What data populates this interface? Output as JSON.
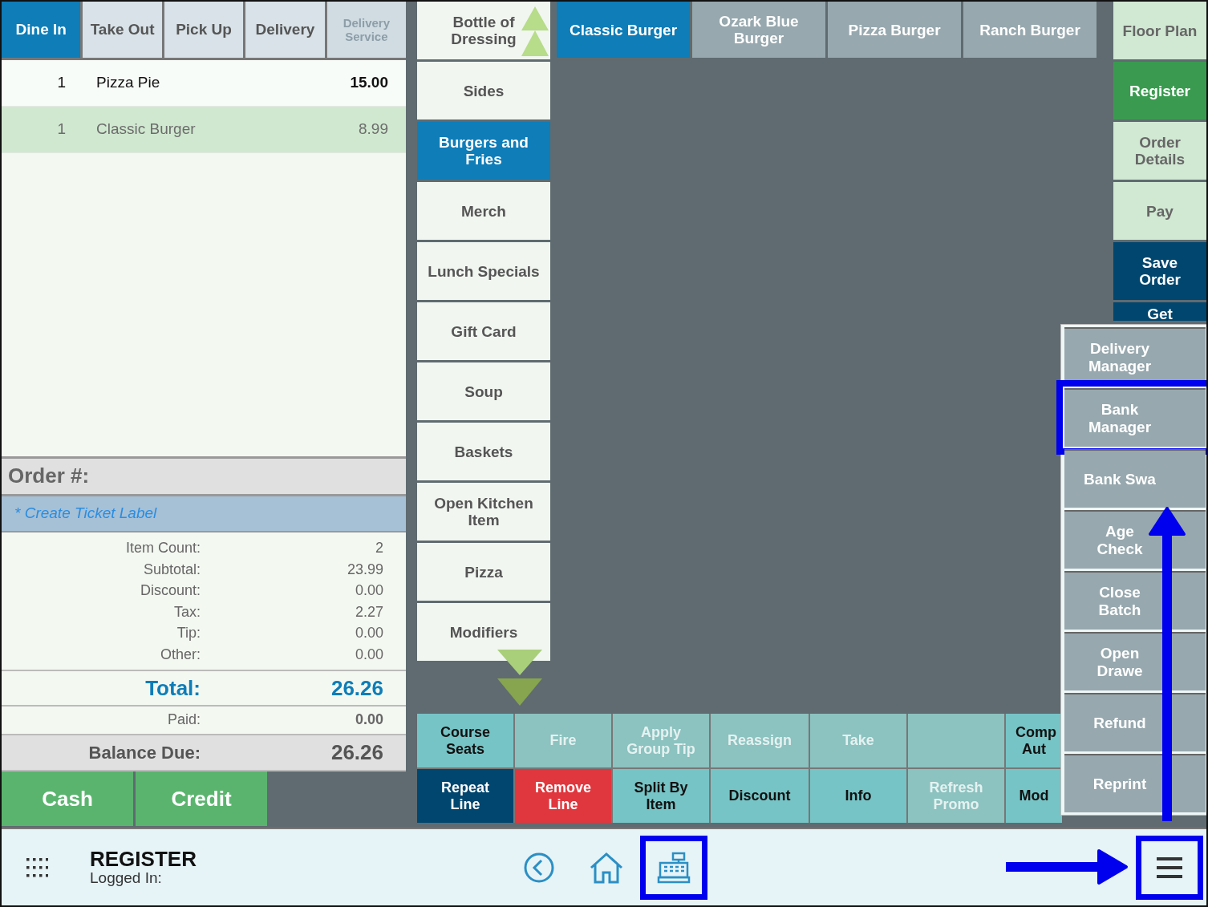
{
  "order_types": [
    {
      "label": "Dine In",
      "selected": true,
      "disabled": false
    },
    {
      "label": "Take Out",
      "selected": false,
      "disabled": false
    },
    {
      "label": "Pick Up",
      "selected": false,
      "disabled": false
    },
    {
      "label": "Delivery",
      "selected": false,
      "disabled": false
    },
    {
      "label": "Delivery Service",
      "selected": false,
      "disabled": true
    }
  ],
  "order_lines": [
    {
      "qty": "1",
      "name": "Pizza Pie",
      "price": "15.00",
      "selected": false
    },
    {
      "qty": "1",
      "name": "Classic Burger",
      "price": "8.99",
      "selected": true
    }
  ],
  "order": {
    "number_label": "Order #:",
    "ticket_label": "* Create Ticket Label",
    "summary": [
      {
        "label": "Item Count:",
        "value": "2"
      },
      {
        "label": "Subtotal:",
        "value": "23.99"
      },
      {
        "label": "Discount:",
        "value": "0.00"
      },
      {
        "label": "Tax:",
        "value": "2.27"
      },
      {
        "label": "Tip:",
        "value": "0.00"
      },
      {
        "label": "Other:",
        "value": "0.00"
      }
    ],
    "total": {
      "label": "Total:",
      "value": "26.26"
    },
    "paid": {
      "label": "Paid:",
      "value": "0.00"
    },
    "balance_due": {
      "label": "Balance Due:",
      "value": "26.26"
    }
  },
  "payment_buttons": [
    "Cash",
    "Credit"
  ],
  "categories": [
    {
      "label": "Bottle of Dressing",
      "selected": false
    },
    {
      "label": "Sides",
      "selected": false
    },
    {
      "label": "Burgers and Fries",
      "selected": true
    },
    {
      "label": "Merch",
      "selected": false
    },
    {
      "label": "Lunch Specials",
      "selected": false
    },
    {
      "label": "Gift Card",
      "selected": false
    },
    {
      "label": "Soup",
      "selected": false
    },
    {
      "label": "Baskets",
      "selected": false
    },
    {
      "label": "Open Kitchen Item",
      "selected": false
    },
    {
      "label": "Pizza",
      "selected": false
    },
    {
      "label": "Modifiers",
      "selected": false
    }
  ],
  "menu_items": [
    {
      "label": "Classic Burger",
      "selected": true
    },
    {
      "label": "Ozark Blue Burger",
      "selected": false
    },
    {
      "label": "Pizza Burger",
      "selected": false
    },
    {
      "label": "Ranch Burger",
      "selected": false
    }
  ],
  "actions": [
    {
      "label": "Course Seats",
      "kind": "normal"
    },
    {
      "label": "Fire",
      "kind": "disabled"
    },
    {
      "label": "Apply Group Tip",
      "kind": "disabled"
    },
    {
      "label": "Reassign",
      "kind": "disabled"
    },
    {
      "label": "Take",
      "kind": "disabled"
    },
    {
      "kind": "disabled"
    },
    {
      "label": "Comp Aut",
      "kind": "normal"
    },
    {
      "label": "Repeat Line",
      "kind": "dark"
    },
    {
      "label": "Remove Line",
      "kind": "danger"
    },
    {
      "label": "Split By Item",
      "kind": "normal"
    },
    {
      "label": "Discount",
      "kind": "normal"
    },
    {
      "label": "Info",
      "kind": "normal"
    },
    {
      "label": "Refresh Promo",
      "kind": "disabled"
    },
    {
      "label": "Mod",
      "kind": "normal"
    }
  ],
  "nav_buttons": [
    {
      "label": "Floor Plan",
      "kind": "light"
    },
    {
      "label": "Register",
      "kind": "active"
    },
    {
      "label": "Order Details",
      "kind": "light"
    },
    {
      "label": "Pay",
      "kind": "light"
    },
    {
      "label": "Save Order",
      "kind": "dark"
    },
    {
      "label": "Get",
      "kind": "dark"
    }
  ],
  "popup_menu": [
    {
      "label": "Delivery Manager",
      "highlighted": false
    },
    {
      "label": "Bank Manager",
      "highlighted": true
    },
    {
      "label": "Bank Swa",
      "highlighted": false
    },
    {
      "label": "Age Check",
      "highlighted": false
    },
    {
      "label": "Close Batch",
      "highlighted": false
    },
    {
      "label": "Open Drawe",
      "highlighted": false
    },
    {
      "label": "Refund",
      "highlighted": false
    },
    {
      "label": "Reprint",
      "highlighted": false
    }
  ],
  "bottom_bar": {
    "title": "REGISTER",
    "logged_in": "Logged In:",
    "buttons": [
      {
        "kind": "back",
        "highlighted": false
      },
      {
        "kind": "home",
        "highlighted": false
      },
      {
        "kind": "register",
        "highlighted": true
      }
    ],
    "menu": {
      "highlighted": true
    }
  },
  "annotations": {
    "popup_arrow": true,
    "menu_arrow": true
  }
}
